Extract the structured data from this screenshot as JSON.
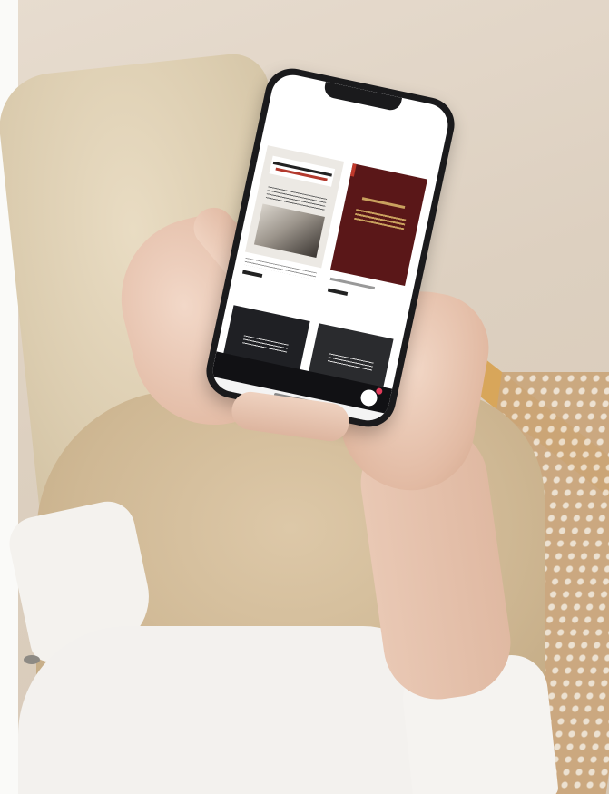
{
  "scene": {
    "subject": "person-holding-phone",
    "phone": {
      "status_time": "",
      "status_icons": "",
      "back_link": "",
      "page_title": "",
      "title_icons": "",
      "filter_link": "",
      "bottom_label": ""
    }
  },
  "colors": {
    "card_dark_red": "#5a1718",
    "gold_text": "#c9a15e",
    "notification_dot": "#e23b5a",
    "chair_rim": "#d8a65a"
  },
  "icons": [
    "chat-icon"
  ]
}
